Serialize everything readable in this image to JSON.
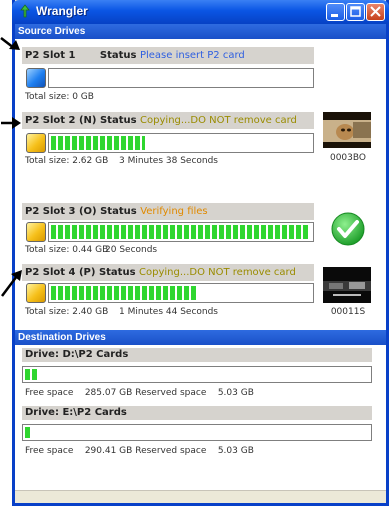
{
  "window": {
    "title": "Wrangler"
  },
  "sections": {
    "source": "Source Drives",
    "destination": "Destination Drives"
  },
  "slots": [
    {
      "label": "P2 Slot 1",
      "status_label": "Status",
      "status": "Please insert P2 card",
      "status_color": "#3060e0",
      "led": "blue",
      "progress": 0,
      "total": "Total size: 0 GB",
      "time": "",
      "clip": ""
    },
    {
      "label": "P2 Slot 2 (N)",
      "status_label": "Status",
      "status": "Copying...DO NOT remove card",
      "status_color": "#9a8c00",
      "led": "yellow",
      "progress": 0.36,
      "total": "Total size: 2.62 GB",
      "time": "3 Minutes 38 Seconds",
      "clip": "0003BO"
    },
    {
      "label": "P2 Slot 3 (O)",
      "status_label": "Status",
      "status": "Verifying files",
      "status_color": "#e08a00",
      "led": "yellow",
      "progress": 0.99,
      "total": "Total size: 0.44 GB",
      "time": "20 Seconds",
      "clip": ""
    },
    {
      "label": "P2 Slot 4 (P)",
      "status_label": "Status",
      "status": "Copying...DO NOT remove card",
      "status_color": "#9a8c00",
      "led": "yellow",
      "progress": 0.56,
      "total": "Total size: 2.40 GB",
      "time": "1 Minutes 44 Seconds",
      "clip": "00011S"
    }
  ],
  "drives": [
    {
      "label": "Drive: D:\\P2 Cards",
      "progress": 0.03,
      "free_label": "Free space",
      "free": "285.07 GB",
      "reserved_label": "Reserved space",
      "reserved": "5.03 GB"
    },
    {
      "label": "Drive: E:\\P2 Cards",
      "progress": 0.015,
      "free_label": "Free space",
      "free": "290.41 GB",
      "reserved_label": "Reserved space",
      "reserved": "5.03 GB"
    }
  ],
  "colors": {
    "titlebar": "#0a55e4",
    "section_bar": "#2e6be0",
    "progress": "#2fd62f",
    "check": "#2dbd3a"
  }
}
